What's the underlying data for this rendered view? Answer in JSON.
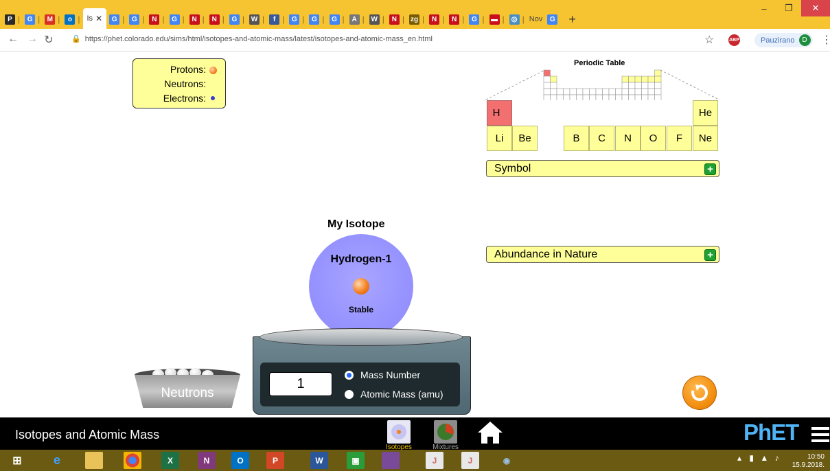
{
  "browser": {
    "active_tab_label": "Is",
    "tabs": [
      {
        "icon": "P",
        "color": "#2a2a2a"
      },
      {
        "icon": "G",
        "color": "#4285f4"
      },
      {
        "icon": "M",
        "color": "#d93025"
      },
      {
        "icon": "o",
        "color": "#0072c6"
      },
      {
        "icon": "G",
        "color": "#4285f4"
      },
      {
        "icon": "G",
        "color": "#4285f4"
      },
      {
        "icon": "N",
        "color": "#c8101c"
      },
      {
        "icon": "G",
        "color": "#4285f4"
      },
      {
        "icon": "N",
        "color": "#c8101c"
      },
      {
        "icon": "N",
        "color": "#c8101c"
      },
      {
        "icon": "G",
        "color": "#4285f4"
      },
      {
        "icon": "W",
        "color": "#555555"
      },
      {
        "icon": "f",
        "color": "#3b5998"
      },
      {
        "icon": "G",
        "color": "#4285f4"
      },
      {
        "icon": "G",
        "color": "#4285f4"
      },
      {
        "icon": "G",
        "color": "#4285f4"
      },
      {
        "icon": "A",
        "color": "#777777"
      },
      {
        "icon": "W",
        "color": "#555555"
      },
      {
        "icon": "N",
        "color": "#c8101c"
      },
      {
        "icon": "zg",
        "color": "#7a5c00"
      },
      {
        "icon": "N",
        "color": "#c8101c"
      },
      {
        "icon": "N",
        "color": "#c8101c"
      },
      {
        "icon": "G",
        "color": "#4285f4"
      },
      {
        "icon": "▬",
        "color": "#c8101c"
      },
      {
        "icon": "◎",
        "color": "#4b8ec4"
      }
    ],
    "last_tab_label": "Nov",
    "url": "https://phet.colorado.edu/sims/html/isotopes-and-atomic-mass/latest/isotopes-and-atomic-mass_en.html",
    "profile_name": "Pauzirano",
    "profile_initial": "D",
    "abp_label": "ABP"
  },
  "legend": {
    "protons_label": "Protons:",
    "neutrons_label": "Neutrons:",
    "electrons_label": "Electrons:",
    "proton_color": "#f5801f",
    "electron_color": "#3a3ad0"
  },
  "periodic_table": {
    "title": "Periodic Table",
    "row1": [
      "H",
      "He"
    ],
    "row2": [
      "Li",
      "Be",
      "B",
      "C",
      "N",
      "O",
      "F",
      "Ne"
    ],
    "selected": "H"
  },
  "panels": {
    "symbol_label": "Symbol",
    "abundance_label": "Abundance in Nature"
  },
  "isotope": {
    "heading": "My Isotope",
    "name": "Hydrogen-1",
    "stability": "Stable"
  },
  "scale": {
    "value": "1",
    "option_mass_number": "Mass Number",
    "option_atomic_mass": "Atomic Mass (amu)",
    "selected_option": "Mass Number"
  },
  "bucket": {
    "label": "Neutrons"
  },
  "navbar": {
    "sim_title": "Isotopes and Atomic Mass",
    "screens": [
      "Isotopes",
      "Mixtures"
    ],
    "active_screen": "Isotopes",
    "brand": "PhET"
  },
  "taskbar": {
    "time": "10:50",
    "date": "15.9.2018."
  }
}
